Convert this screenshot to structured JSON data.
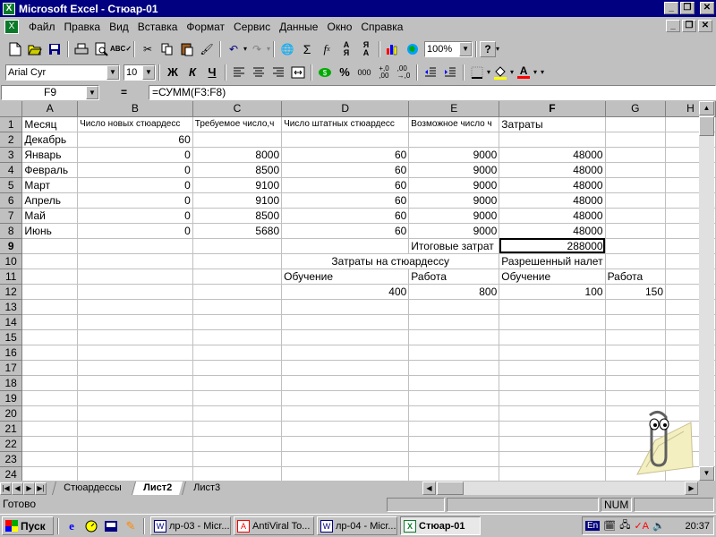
{
  "window": {
    "title": "Microsoft Excel - Стюар-01",
    "app_icon": "excel-icon",
    "buttons": [
      "_",
      "❐",
      "✕"
    ]
  },
  "menu": {
    "items": [
      "Файл",
      "Правка",
      "Вид",
      "Вставка",
      "Формат",
      "Сервис",
      "Данные",
      "Окно",
      "Справка"
    ]
  },
  "toolbar1": {
    "icons": [
      "new-icon",
      "open-icon",
      "save-icon",
      "print-icon",
      "print-preview-icon",
      "spelling-icon",
      "cut-icon",
      "copy-icon",
      "paste-icon",
      "format-painter-icon",
      "undo-icon",
      "redo-icon",
      "hyperlink-icon",
      "autosum-icon",
      "function-icon",
      "sort-asc-icon",
      "sort-desc-icon",
      "chart-wizard-icon",
      "map-icon",
      "help-icon"
    ],
    "zoom": "100%"
  },
  "toolbar2": {
    "font": "Arial Cyr",
    "size": "10",
    "bold": "Ж",
    "italic": "К",
    "underline": "Ч"
  },
  "formula_bar": {
    "name_box": "F9",
    "equals": "=",
    "formula": "=СУММ(F3:F8)"
  },
  "columns": [
    "A",
    "B",
    "C",
    "D",
    "E",
    "F",
    "G",
    "H"
  ],
  "rows": [
    {
      "n": "1",
      "A": "Месяц",
      "B": "Число новых стюардесс",
      "C": "Требуемое число,ч",
      "D": "Число штатных стюардесс",
      "E": "Возможное число ч",
      "F": "Затраты",
      "G": "",
      "H": ""
    },
    {
      "n": "2",
      "A": "Декабрь",
      "B": "60",
      "C": "",
      "D": "",
      "E": "",
      "F": "",
      "G": "",
      "H": ""
    },
    {
      "n": "3",
      "A": "Январь",
      "B": "0",
      "C": "8000",
      "D": "60",
      "E": "9000",
      "F": "48000",
      "G": "",
      "H": ""
    },
    {
      "n": "4",
      "A": "Февраль",
      "B": "0",
      "C": "8500",
      "D": "60",
      "E": "9000",
      "F": "48000",
      "G": "",
      "H": ""
    },
    {
      "n": "5",
      "A": "Март",
      "B": "0",
      "C": "9100",
      "D": "60",
      "E": "9000",
      "F": "48000",
      "G": "",
      "H": ""
    },
    {
      "n": "6",
      "A": "Апрель",
      "B": "0",
      "C": "9100",
      "D": "60",
      "E": "9000",
      "F": "48000",
      "G": "",
      "H": ""
    },
    {
      "n": "7",
      "A": "Май",
      "B": "0",
      "C": "8500",
      "D": "60",
      "E": "9000",
      "F": "48000",
      "G": "",
      "H": ""
    },
    {
      "n": "8",
      "A": "Июнь",
      "B": "0",
      "C": "5680",
      "D": "60",
      "E": "9000",
      "F": "48000",
      "G": "",
      "H": ""
    },
    {
      "n": "9",
      "A": "",
      "B": "",
      "C": "",
      "D": "",
      "E": "Итоговые затрат",
      "F": "288000",
      "G": "",
      "H": ""
    },
    {
      "n": "10",
      "A": "",
      "B": "",
      "C": "",
      "D": "Затраты на стюардессу",
      "E": "",
      "F": "Разрешенный налет",
      "G": "",
      "H": ""
    },
    {
      "n": "11",
      "A": "",
      "B": "",
      "C": "",
      "D": "Обучение",
      "E": "Работа",
      "F": "Обучение",
      "G": "Работа",
      "H": ""
    },
    {
      "n": "12",
      "A": "",
      "B": "",
      "C": "",
      "D": "400",
      "E": "800",
      "F": "100",
      "G": "150",
      "H": ""
    },
    {
      "n": "13"
    },
    {
      "n": "14"
    },
    {
      "n": "15"
    },
    {
      "n": "16"
    },
    {
      "n": "17"
    },
    {
      "n": "18"
    },
    {
      "n": "19"
    },
    {
      "n": "20"
    },
    {
      "n": "21"
    },
    {
      "n": "22"
    },
    {
      "n": "23"
    },
    {
      "n": "24"
    }
  ],
  "sheet_tabs": [
    {
      "label": "Стюардессы",
      "active": false
    },
    {
      "label": "Лист2",
      "active": true
    },
    {
      "label": "Лист3",
      "active": false
    }
  ],
  "status": {
    "text": "Готово",
    "num": "NUM"
  },
  "taskbar": {
    "start": "Пуск",
    "tasks": [
      {
        "label": "лр-03 - Micr...",
        "icon": "W"
      },
      {
        "label": "AntiViral To...",
        "icon": "A"
      },
      {
        "label": "лр-04 - Micr...",
        "icon": "W"
      },
      {
        "label": "Стюар-01",
        "icon": "X",
        "active": true
      }
    ],
    "lang": "En",
    "clock": "20:37"
  }
}
